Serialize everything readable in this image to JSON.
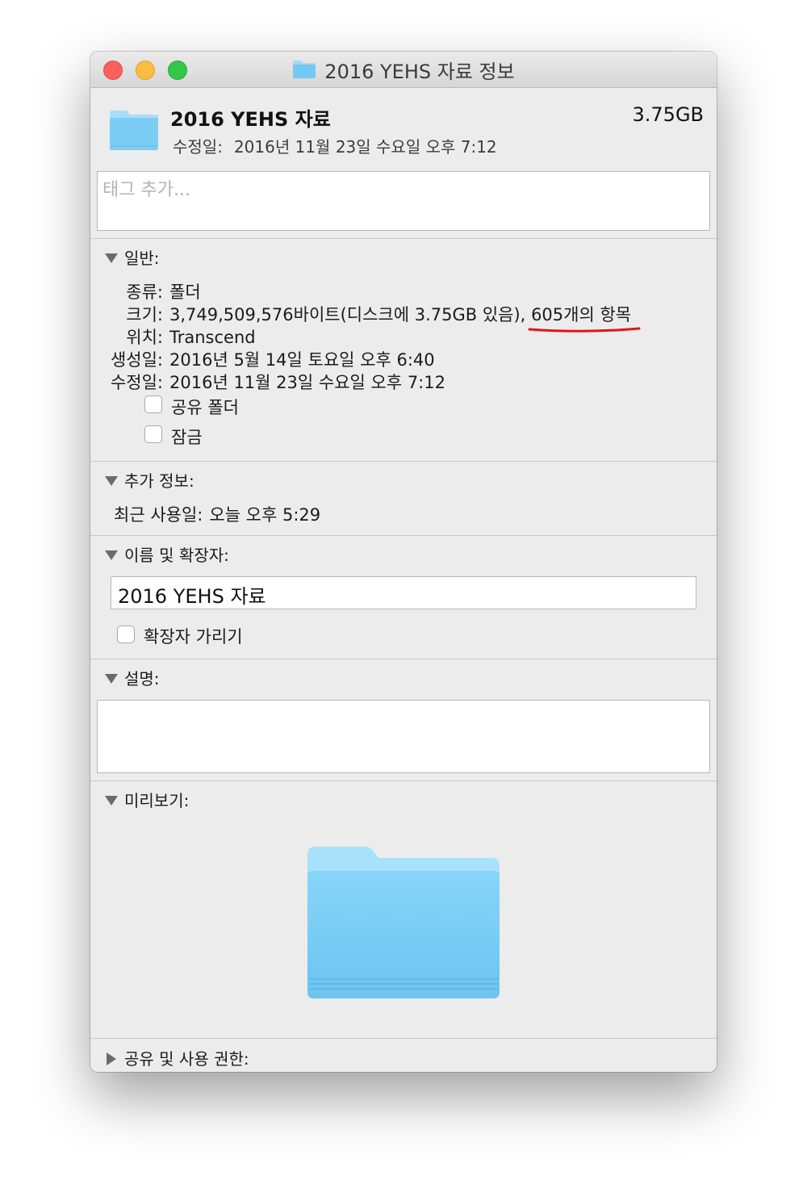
{
  "window": {
    "title": "2016 YEHS 자료 정보",
    "folder_color": "#7fd0f7"
  },
  "header": {
    "name": "2016 YEHS 자료",
    "size": "3.75GB",
    "modified_label": "수정일:",
    "modified_value": "2016년 11월 23일 수요일 오후 7:12"
  },
  "tags": {
    "placeholder": "태그 추가..."
  },
  "general": {
    "title": "일반:",
    "kind_label": "종류:",
    "kind_value": "폴더",
    "size_label": "크기:",
    "size_value": "3,749,509,576바이트(디스크에 3.75GB 있음),",
    "size_items": "605개의 항목",
    "where_label": "위치:",
    "where_value": "Transcend",
    "created_label": "생성일:",
    "created_value": "2016년 5월 14일 토요일 오후 6:40",
    "modified_label": "수정일:",
    "modified_value": "2016년 11월 23일 수요일 오후 7:12",
    "shared_folder_label": "공유 폴더",
    "locked_label": "잠금"
  },
  "more_info": {
    "title": "추가 정보:",
    "last_opened_label": "최근 사용일:",
    "last_opened_value": "오늘 오후 5:29"
  },
  "name_ext": {
    "title": "이름 및 확장자:",
    "value": "2016 YEHS 자료",
    "hide_ext_label": "확장자 가리기"
  },
  "comments": {
    "title": "설명:"
  },
  "preview": {
    "title": "미리보기:"
  },
  "sharing": {
    "title": "공유 및 사용 권한:"
  },
  "annotation_color": "#e0141b"
}
